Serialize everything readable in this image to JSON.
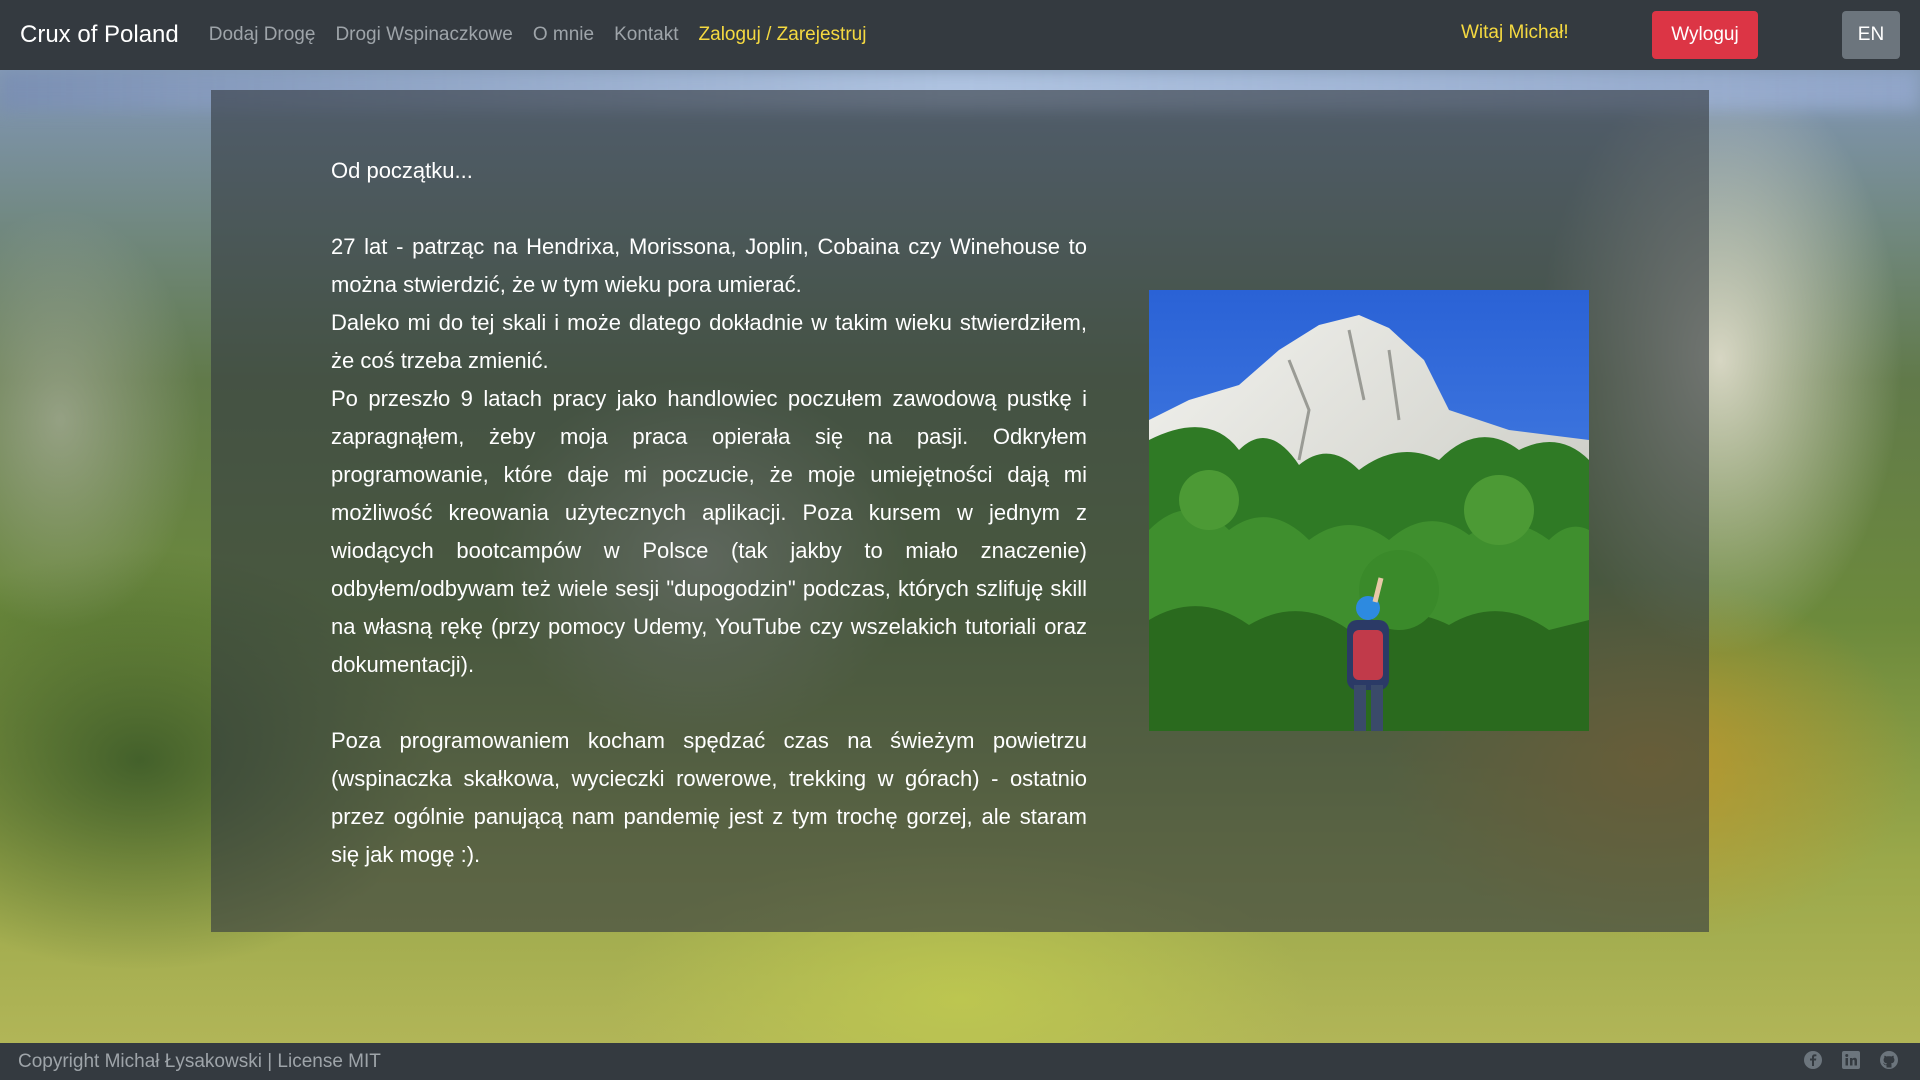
{
  "navbar": {
    "brand": "Crux of Poland",
    "links": [
      {
        "label": "Dodaj Drogę"
      },
      {
        "label": "Drogi Wspinaczkowe"
      },
      {
        "label": "O mnie"
      },
      {
        "label": "Kontakt"
      },
      {
        "label": "Zaloguj / Zarejestruj"
      }
    ],
    "welcome": "Witaj Michał!",
    "logout_label": "Wyloguj",
    "lang_label": "EN"
  },
  "content": {
    "heading": "Od początku...",
    "paragraph1": "27 lat - patrząc na Hendrixa, Morissona, Joplin, Cobaina czy Winehouse to można stwierdzić, że w tym wieku pora umierać.",
    "paragraph2": "Daleko mi do tej skali i może dlatego dokładnie w takim wieku stwierdziłem, że coś trzeba zmienić.",
    "paragraph3": "Po przeszło 9 latach pracy jako handlowiec poczułem zawodową pustkę i zapragnąłem, żeby moja praca opierała się na pasji. Odkryłem programowanie, które daje mi poczucie, że moje umiejętności dają mi możliwość kreowania użytecznych aplikacji. Poza kursem w jednym z wiodących bootcampów w Polsce (tak jakby to miało znaczenie) odbyłem/odbywam też wiele sesji \"dupogodzin\" podczas, których szlifuję skill na własną rękę (przy pomocy Udemy, YouTube czy wszelakich tutoriali oraz dokumentacji).",
    "paragraph4": "Poza programowaniem kocham spędzać czas na świeżym powietrzu (wspinaczka skałkowa, wycieczki rowerowe, trekking w górach) - ostatnio przez ogólnie panującą nam pandemię jest z tym trochę gorzej, ale staram się jak mogę :)."
  },
  "footer": {
    "copyright": "Copyright Michał Łysakowski | License MIT",
    "icons": [
      "facebook-icon",
      "linkedin-icon",
      "github-icon"
    ]
  },
  "colors": {
    "navbar_bg": "#343a40",
    "accent_yellow": "#f5d940",
    "logout_red": "#dc3545",
    "lang_gray": "#6c757d",
    "link_gray": "#9ea4a9"
  }
}
